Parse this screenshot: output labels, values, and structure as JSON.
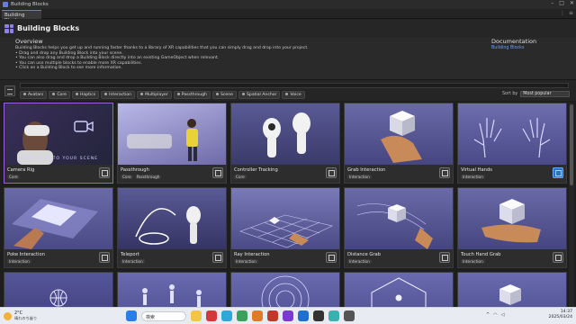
{
  "window": {
    "title": "Building Blocks",
    "tab": "Building Blocks"
  },
  "header": {
    "title": "Building Blocks"
  },
  "overview": {
    "heading": "Overview",
    "lines": [
      "Building Blocks helps you get up and running faster thanks to a library of XR capabilities that you can simply drag and drop into your project.",
      "• Drag and drop any Building Block into your scene.",
      "• You can also drag and drop a Building Block directly into an existing GameObject when relevant.",
      "• You can use multiple blocks to enable more XR capabilities.",
      "• Click on a Building Block to see more information."
    ],
    "doc_heading": "Documentation",
    "doc_link": "Building Blocks"
  },
  "filter": {
    "search_value": "",
    "chips": [
      "Avatars",
      "Core",
      "Haptics",
      "Interaction",
      "Multiplayer",
      "Passthrough",
      "Scene",
      "Spatial Anchor",
      "Voice"
    ],
    "sort_label": "Sort by",
    "sort_value": "Most popular"
  },
  "cards": [
    {
      "name": "Camera Rig",
      "tags": [
        "Core"
      ],
      "drop": "DROP ME INTO YOUR SCENE",
      "selected": true
    },
    {
      "name": "Passthrough",
      "tags": [
        "Core",
        "Passthrough"
      ]
    },
    {
      "name": "Controller Tracking",
      "tags": [
        "Core"
      ]
    },
    {
      "name": "Grab Interaction",
      "tags": [
        "Interaction"
      ]
    },
    {
      "name": "Virtual Hands",
      "tags": [
        "Interaction"
      ],
      "highlight": true
    },
    {
      "name": "Poke Interaction",
      "tags": [
        "Interaction"
      ]
    },
    {
      "name": "Teleport",
      "tags": [
        "Interaction"
      ]
    },
    {
      "name": "Ray Interaction",
      "tags": [
        "Interaction"
      ]
    },
    {
      "name": "Distance Grab",
      "tags": [
        "Interaction"
      ]
    },
    {
      "name": "Touch Hand Grab",
      "tags": [
        "Interaction"
      ]
    }
  ],
  "taskbar": {
    "temp": "2°C",
    "weather_text": "晴れのち曇り",
    "search": "検索",
    "time": "14:37",
    "date": "2025/03/24"
  }
}
